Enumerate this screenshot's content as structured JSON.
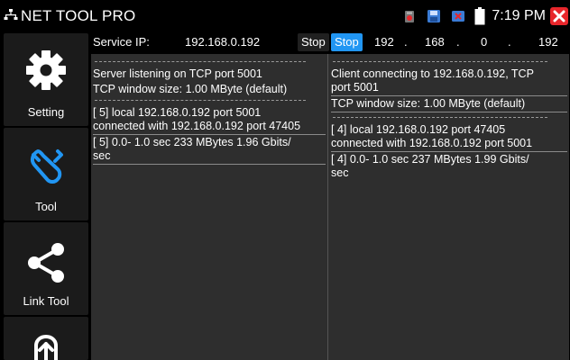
{
  "app": {
    "title": "NET TOOL PRO"
  },
  "status": {
    "time": "7:19 PM"
  },
  "icons": {
    "app": "network-icon",
    "status": [
      "recording-icon",
      "save-icon",
      "dismiss-icon",
      "battery-icon",
      "close-icon"
    ]
  },
  "sidebar": {
    "items": [
      {
        "label": "Setting",
        "icon": "gear-icon"
      },
      {
        "label": "Tool",
        "icon": "wrench-icon"
      },
      {
        "label": "Link Tool",
        "icon": "share-icon"
      },
      {
        "label": "",
        "icon": "upload-icon"
      }
    ]
  },
  "topbar": {
    "service_label": "Service IP:",
    "service_ip": "192.168.0.192",
    "stop_server": "Stop",
    "stop_client": "Stop",
    "ip_octets": [
      "192",
      "168",
      "0",
      "192"
    ],
    "dot": "."
  },
  "server_log": {
    "listening": "Server listening on TCP port 5001",
    "window": "TCP window size: 1.00 MByte (default)",
    "local_1": "[  5] local 192.168.0.192 port 5001",
    "local_2": "connected with 192.168.0.192 port 47405",
    "result_1": "[  5]  0.0- 1.0 sec    233 MBytes  1.96 Gbits/",
    "result_2": "sec"
  },
  "client_log": {
    "connecting_1": "Client connecting to 192.168.0.192, TCP",
    "connecting_2": "port 5001",
    "window": "TCP window size: 1.00 MByte (default)",
    "local_1": "[  4] local 192.168.0.192 port 47405",
    "local_2": "connected with 192.168.0.192 port 5001",
    "result_1": "[  4]  0.0- 1.0 sec    237 MBytes  1.99 Gbits/",
    "result_2": "sec"
  },
  "colors": {
    "accent": "#2196f3",
    "close": "#e8262b",
    "panel": "#2e2e2e",
    "sidebar_item": "#1b1b1b"
  }
}
